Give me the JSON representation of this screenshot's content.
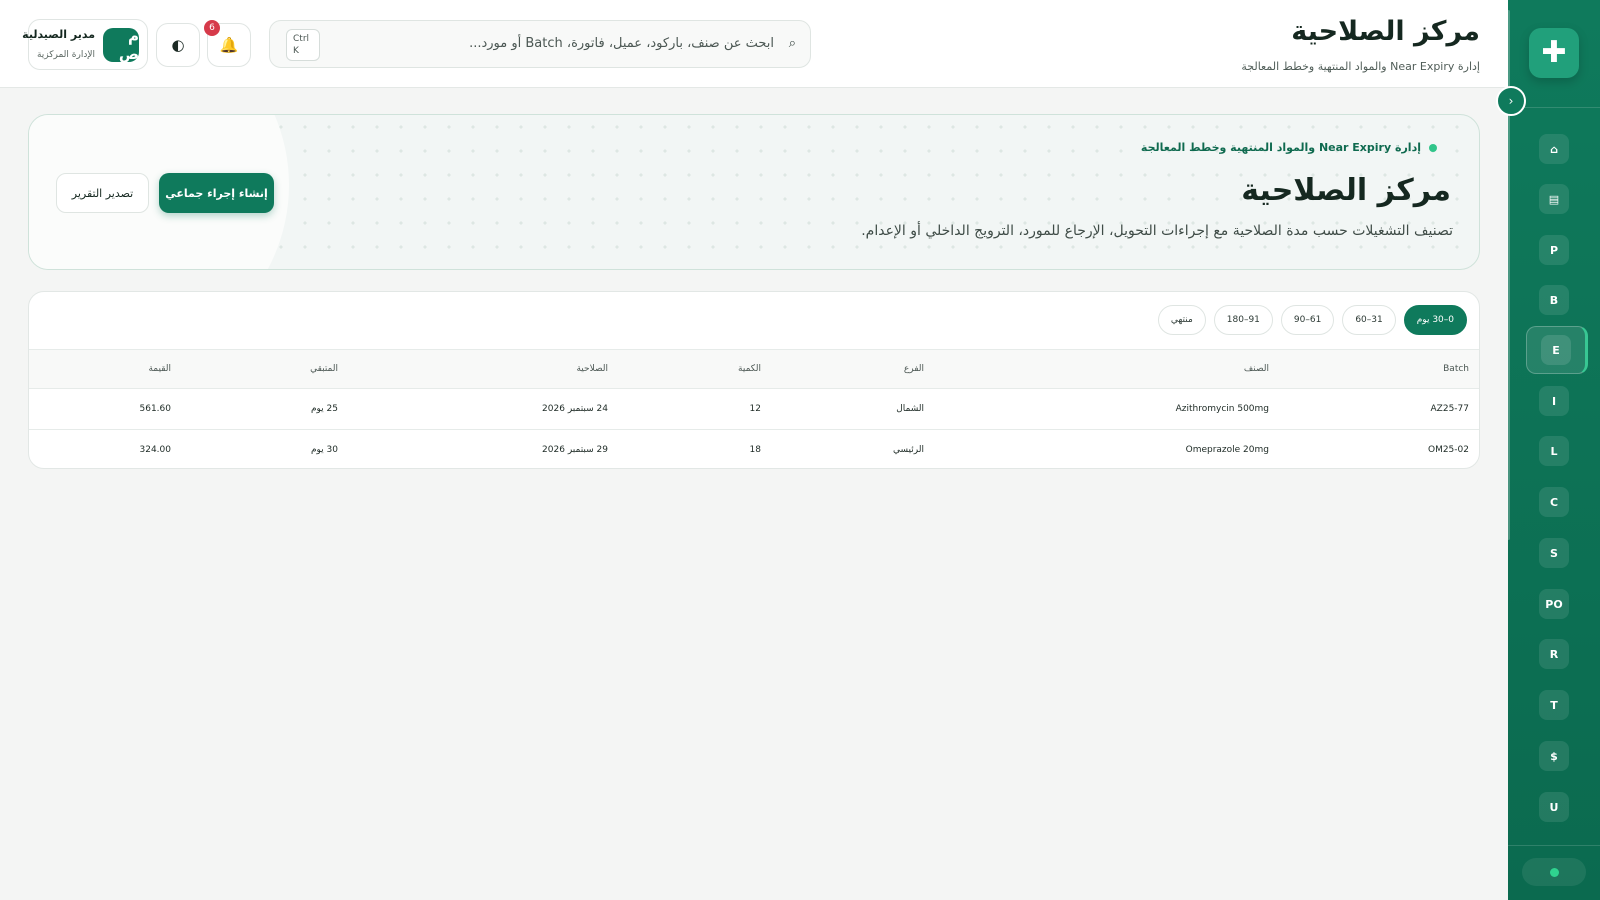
{
  "header": {
    "title": "مركز الصلاحية",
    "subtitle": "إدارة Near Expiry والمواد المنتهية وخطط المعالجة",
    "search_placeholder": "ابحث عن صنف، باركود، عميل، فاتورة، Batch أو مورد...",
    "search_icon": "⌕",
    "shortcut_line1": "Ctrl",
    "shortcut_line2": "K",
    "notifications_count": "6",
    "bell_icon": "🔔",
    "theme_icon": "◐",
    "user": {
      "avatar_initials": "م ص",
      "name": "مدير الصيدلية",
      "role": "الإدارة المركزية"
    }
  },
  "hero": {
    "eyebrow": "إدارة Near Expiry والمواد المنتهية وخطط المعالجة",
    "title": "مركز الصلاحية",
    "description": "تصنيف التشغيلات حسب مدة الصلاحية مع إجراءات التحويل، الإرجاع للمورد، الترويج الداخلي أو الإعدام.",
    "primary_button": "إنشاء إجراء جماعي",
    "secondary_button": "تصدير التقرير"
  },
  "filters": [
    {
      "label": "0–30 يوم",
      "active": true
    },
    {
      "label": "31–60",
      "active": false
    },
    {
      "label": "61–90",
      "active": false
    },
    {
      "label": "91–180",
      "active": false
    },
    {
      "label": "منتهي",
      "active": false
    }
  ],
  "table": {
    "columns": [
      "Batch",
      "الصنف",
      "الفرع",
      "الكمية",
      "الصلاحية",
      "المتبقي",
      "القيمة"
    ],
    "rows": [
      [
        "AZ25-77",
        "Azithromycin 500mg",
        "الشمال",
        "12",
        "24 سبتمبر 2026",
        "25 يوم",
        "561.60"
      ],
      [
        "OM25-02",
        "Omeprazole 20mg",
        "الرئيسي",
        "18",
        "29 سبتمبر 2026",
        "30 يوم",
        "324.00"
      ]
    ]
  },
  "sidebar": {
    "logo_icon": "✚",
    "collapse_icon": "›",
    "items": [
      {
        "label": "⌂",
        "active": false
      },
      {
        "label": "▤",
        "active": false
      },
      {
        "label": "P",
        "active": false
      },
      {
        "label": "B",
        "active": false
      },
      {
        "label": "E",
        "active": true
      },
      {
        "label": "I",
        "active": false
      },
      {
        "label": "L",
        "active": false
      },
      {
        "label": "C",
        "active": false
      },
      {
        "label": "S",
        "active": false
      },
      {
        "label": "PO",
        "active": false
      },
      {
        "label": "R",
        "active": false
      },
      {
        "label": "T",
        "active": false
      },
      {
        "label": "$",
        "active": false
      },
      {
        "label": "U",
        "active": false
      }
    ]
  },
  "colors": {
    "brand": "#0f7a5c",
    "sidebar": "#0b6a4f",
    "badge": "#d63a4a",
    "status_dot": "#2fd38f"
  }
}
